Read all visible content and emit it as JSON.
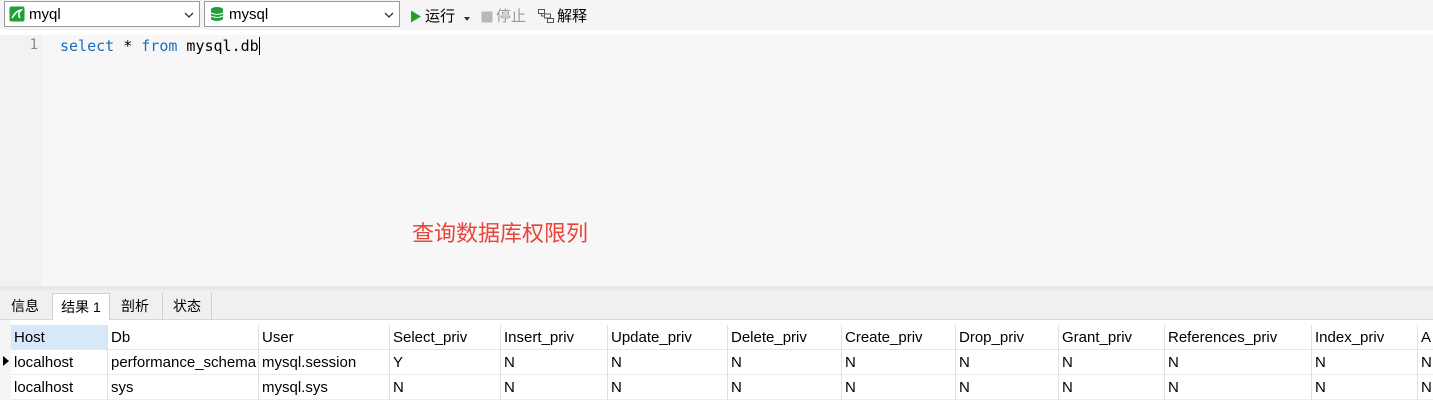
{
  "toolbar": {
    "connection": "myql",
    "database": "mysql",
    "run_label": "运行",
    "stop_label": "停止",
    "explain_label": "解释"
  },
  "editor": {
    "line_number": "1",
    "code": {
      "kw1": "select",
      "mid": " * ",
      "kw2": "from",
      "rest": " mysql.db"
    },
    "annotation": "查询数据库权限列"
  },
  "result_tabs": [
    "信息",
    "结果 1",
    "剖析",
    "状态"
  ],
  "grid": {
    "columns": [
      "Host",
      "Db",
      "User",
      "Select_priv",
      "Insert_priv",
      "Update_priv",
      "Delete_priv",
      "Create_priv",
      "Drop_priv",
      "Grant_priv",
      "References_priv",
      "Index_priv",
      "A"
    ],
    "rows": [
      [
        "localhost",
        "performance_schema",
        "mysql.session",
        "Y",
        "N",
        "N",
        "N",
        "N",
        "N",
        "N",
        "N",
        "N",
        "N"
      ],
      [
        "localhost",
        "sys",
        "mysql.sys",
        "N",
        "N",
        "N",
        "N",
        "N",
        "N",
        "N",
        "N",
        "N",
        "N"
      ]
    ]
  },
  "colors": {
    "keyword": "#1c6cbd",
    "annotation": "#e9443a",
    "run_icon": "#22a32a",
    "db_icon": "#1f9e3a",
    "selected_header": "#d7e8f8"
  }
}
